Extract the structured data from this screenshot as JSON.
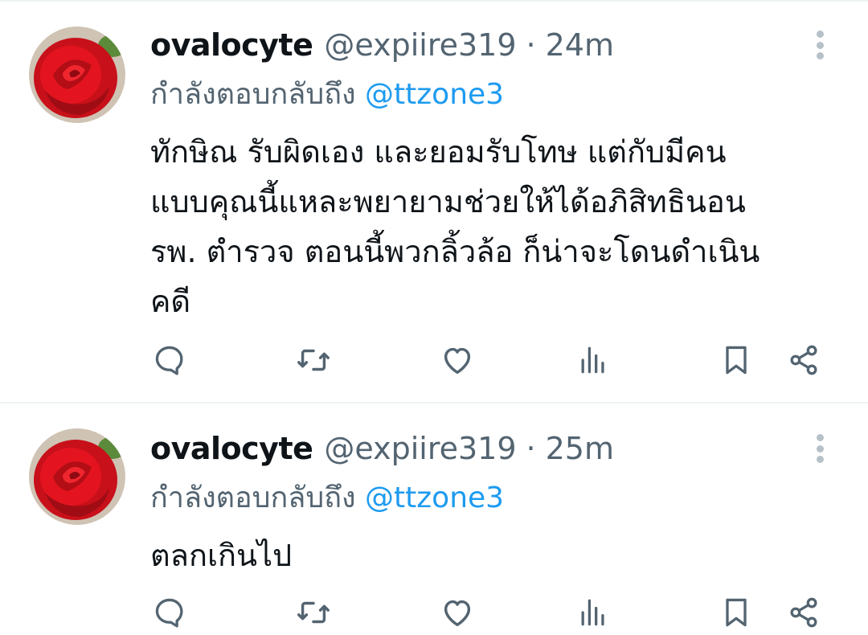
{
  "colors": {
    "text_primary": "#0f1419",
    "text_secondary": "#536471",
    "link": "#1d9bf0",
    "divider": "#eff3f4",
    "icon": "#536471"
  },
  "tweets": [
    {
      "display_name": "ovalocyte",
      "handle": "@expiire319",
      "separator": "·",
      "time": "24m",
      "replying_prefix": "กำลังตอบกลับถึง",
      "replying_to": "@ttzone3",
      "body_lines": [
        "ทักษิณ รับผิดเอง และยอมรับโทษ แต่กับมีคน",
        "แบบคุณนี้แหละพยายามช่วยให้ได้อภิสิทธินอน",
        "รพ. ตำรวจ ตอนนี้พวกลิ้วล้อ ก็น่าจะโดนดำเนิน",
        "คดี"
      ],
      "avatar_icon": "red-rose-avatar",
      "actions": [
        "reply-icon",
        "retweet-icon",
        "like-icon",
        "views-icon",
        "bookmark-icon",
        "share-icon"
      ]
    },
    {
      "display_name": "ovalocyte",
      "handle": "@expiire319",
      "separator": "·",
      "time": "25m",
      "replying_prefix": "กำลังตอบกลับถึง",
      "replying_to": "@ttzone3",
      "body_lines": [
        "ตลกเกินไป"
      ],
      "avatar_icon": "red-rose-avatar",
      "actions": [
        "reply-icon",
        "retweet-icon",
        "like-icon",
        "views-icon",
        "bookmark-icon",
        "share-icon"
      ]
    }
  ]
}
